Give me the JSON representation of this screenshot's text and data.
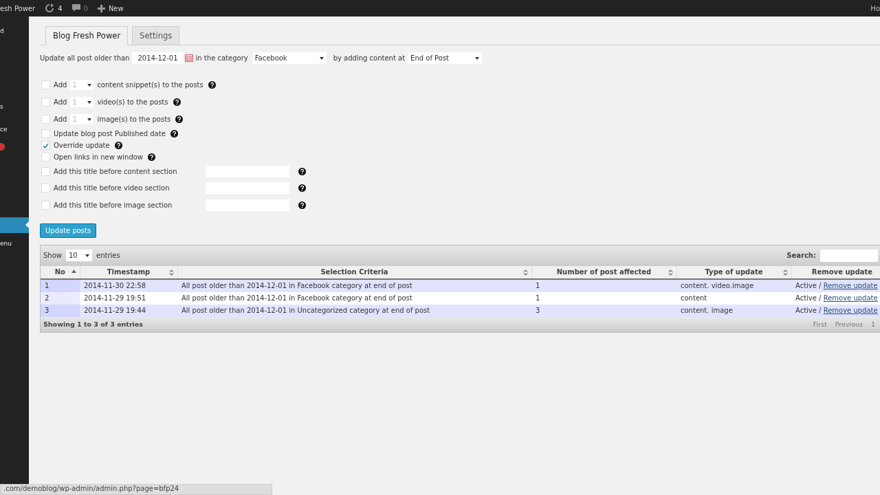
{
  "admin_bar": {
    "site_name": "esh Power",
    "updates": "4",
    "comments": "0",
    "new": "New",
    "account": "Ho"
  },
  "sidebar": {
    "items": [
      {
        "kind": "text",
        "label": "d"
      },
      {
        "kind": "text",
        "label": "s"
      },
      {
        "kind": "text",
        "label": "ce"
      },
      {
        "kind": "badge"
      },
      {
        "kind": "current"
      },
      {
        "kind": "text",
        "label": "enu"
      }
    ]
  },
  "tabs": [
    {
      "label": "Blog Fresh Power",
      "selected": true
    },
    {
      "label": "Settings",
      "selected": false
    }
  ],
  "filter": {
    "prefix": "Update all post older than",
    "date": "2014-12-01",
    "category_label": "in the category",
    "category": "Facebook",
    "position_label": "by adding content at",
    "position": "End of Post"
  },
  "options": [
    {
      "kind": "count",
      "checked": false,
      "before": "Add",
      "count": "1",
      "label": "content snippet(s) to the posts"
    },
    {
      "kind": "count",
      "checked": false,
      "before": "Add",
      "count": "1",
      "label": "video(s) to the posts"
    },
    {
      "kind": "count",
      "checked": false,
      "before": "Add",
      "count": "1",
      "label": "image(s) to the posts"
    },
    {
      "kind": "check",
      "checked": false,
      "label": "Update blog post Published date"
    },
    {
      "kind": "check",
      "checked": true,
      "label": "Override update"
    },
    {
      "kind": "check",
      "checked": false,
      "label": "Open links in new window"
    },
    {
      "kind": "title",
      "checked": false,
      "label": "Add this title before content section"
    },
    {
      "kind": "title",
      "checked": false,
      "label": "Add this title before video section"
    },
    {
      "kind": "title",
      "checked": false,
      "label": "Add this title before image section"
    }
  ],
  "submit": "Update posts",
  "table": {
    "show_label": "Show",
    "page_size": "10",
    "entries_label": "entries",
    "search_label": "Search:",
    "columns": [
      {
        "label": "No",
        "sortable": true,
        "sorted": true
      },
      {
        "label": "Timestamp",
        "sortable": true,
        "sorted": false
      },
      {
        "label": "Selection Criteria",
        "sortable": true,
        "sorted": false
      },
      {
        "label": "Number of post affected",
        "sortable": true,
        "sorted": false
      },
      {
        "label": "Type of update",
        "sortable": true,
        "sorted": false
      },
      {
        "label": "Remove update"
      }
    ],
    "rows": [
      {
        "no": "1",
        "timestamp": "2014-11-30 22:58",
        "criteria": "All post older than 2014-12-01 in Facebook category at end of post",
        "count": "1",
        "type": "content. video.image",
        "status": "Active /",
        "link": "Remove update"
      },
      {
        "no": "2",
        "timestamp": "2014-11-29 19:51",
        "criteria": "All post older than 2014-12-01 in Facebook category at end of post",
        "count": "1",
        "type": "content",
        "status": "Active /",
        "link": "Remove update"
      },
      {
        "no": "3",
        "timestamp": "2014-11-29 19:44",
        "criteria": "All post older than 2014-12-01 in Uncategorized category at end of post",
        "count": "3",
        "type": "content. image",
        "status": "Active /",
        "link": "Remove update"
      }
    ],
    "info": "Showing 1 to 3 of 3 entries",
    "pagination": [
      "First",
      "Previous",
      "1"
    ]
  },
  "status_url": ".com/demoblog/wp-admin/admin.php?page=bfp24"
}
